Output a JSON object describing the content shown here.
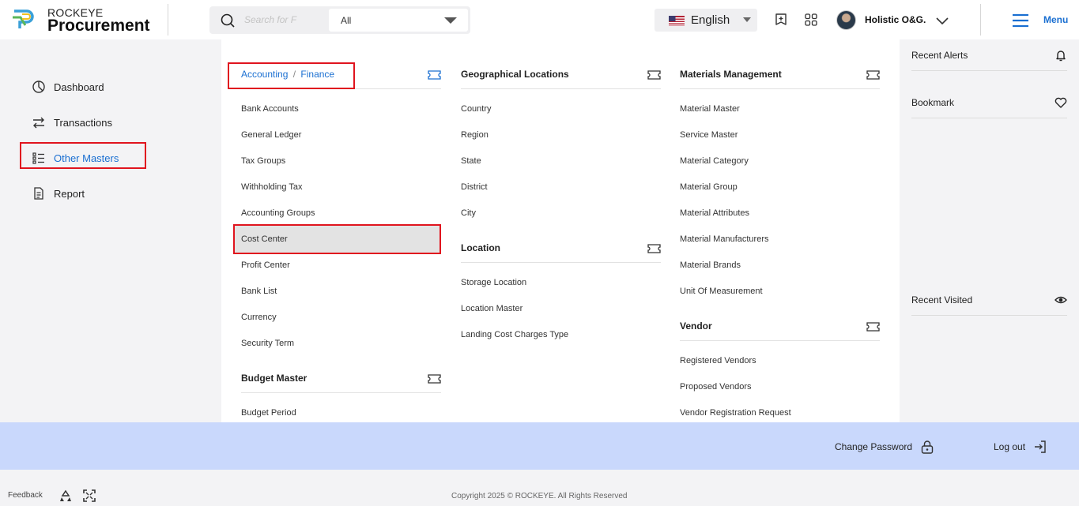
{
  "header": {
    "brand_top": "ROCKEYE",
    "brand_main": "Procurement",
    "search": {
      "placeholder": "Search for F",
      "scope": "All"
    },
    "language": "English",
    "user_name": "Holistic O&G.",
    "menu_label": "Menu"
  },
  "sidebar": {
    "items": [
      {
        "label": "Dashboard",
        "icon": "pie-chart-icon"
      },
      {
        "label": "Transactions",
        "icon": "transfer-arrows-icon"
      },
      {
        "label": "Other Masters",
        "icon": "list-icon",
        "active": true
      },
      {
        "label": "Report",
        "icon": "document-icon"
      }
    ]
  },
  "mega_menu": {
    "accounting": {
      "title_part1": "Accounting",
      "title_sep": "/",
      "title_part2": "Finance",
      "links": [
        "Bank Accounts",
        "General Ledger",
        "Tax Groups",
        "Withholding Tax",
        "Accounting Groups",
        "Cost Center",
        "Profit Center",
        "Bank List",
        "Currency",
        "Security Term"
      ],
      "selected": "Cost Center"
    },
    "budget": {
      "title": "Budget Master",
      "links": [
        "Budget Period"
      ]
    },
    "geo": {
      "title": "Geographical Locations",
      "links": [
        "Country",
        "Region",
        "State",
        "District",
        "City"
      ]
    },
    "location": {
      "title": "Location",
      "links": [
        "Storage Location",
        "Location Master",
        "Landing Cost Charges Type"
      ]
    },
    "materials": {
      "title": "Materials Management",
      "links": [
        "Material Master",
        "Service Master",
        "Material Category",
        "Material Group",
        "Material Attributes",
        "Material Manufacturers",
        "Material Brands",
        "Unit Of Measurement"
      ]
    },
    "vendor": {
      "title": "Vendor",
      "links": [
        "Registered Vendors",
        "Proposed Vendors",
        "Vendor Registration Request"
      ]
    }
  },
  "right_panel": {
    "recent_alerts": "Recent Alerts",
    "bookmark": "Bookmark",
    "recent_visited": "Recent Visited"
  },
  "bottom_bar": {
    "change_password": "Change Password",
    "log_out": "Log out"
  },
  "footer": {
    "feedback": "Feedback",
    "copyright": "Copyright 2025 © ROCKEYE. All Rights Reserved"
  },
  "colors": {
    "accent": "#1a6fd1",
    "highlight_border": "#e0141e",
    "bottom_bar": "#c9d8fc"
  }
}
